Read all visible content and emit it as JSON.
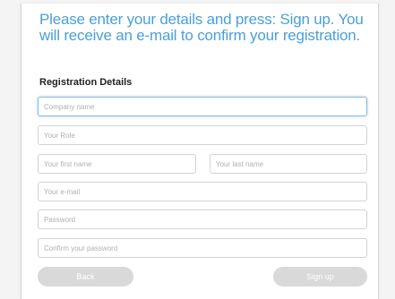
{
  "form": {
    "intro": "Please enter your details and press: Sign up. You will receive an e-mail to confirm your registration.",
    "section_title": "Registration Details",
    "fields": {
      "company": "Company name",
      "role": "Your Role",
      "first_name": "Your first name",
      "last_name": "Your last name",
      "email": "Your e-mail",
      "password": "Password",
      "confirm_password": "Confirm your password"
    },
    "buttons": {
      "back": "Back",
      "signup": "Sign up"
    }
  },
  "colors": {
    "accent": "#4a9fd8",
    "button": "#d9d9d9",
    "border": "#d3d3d3"
  }
}
